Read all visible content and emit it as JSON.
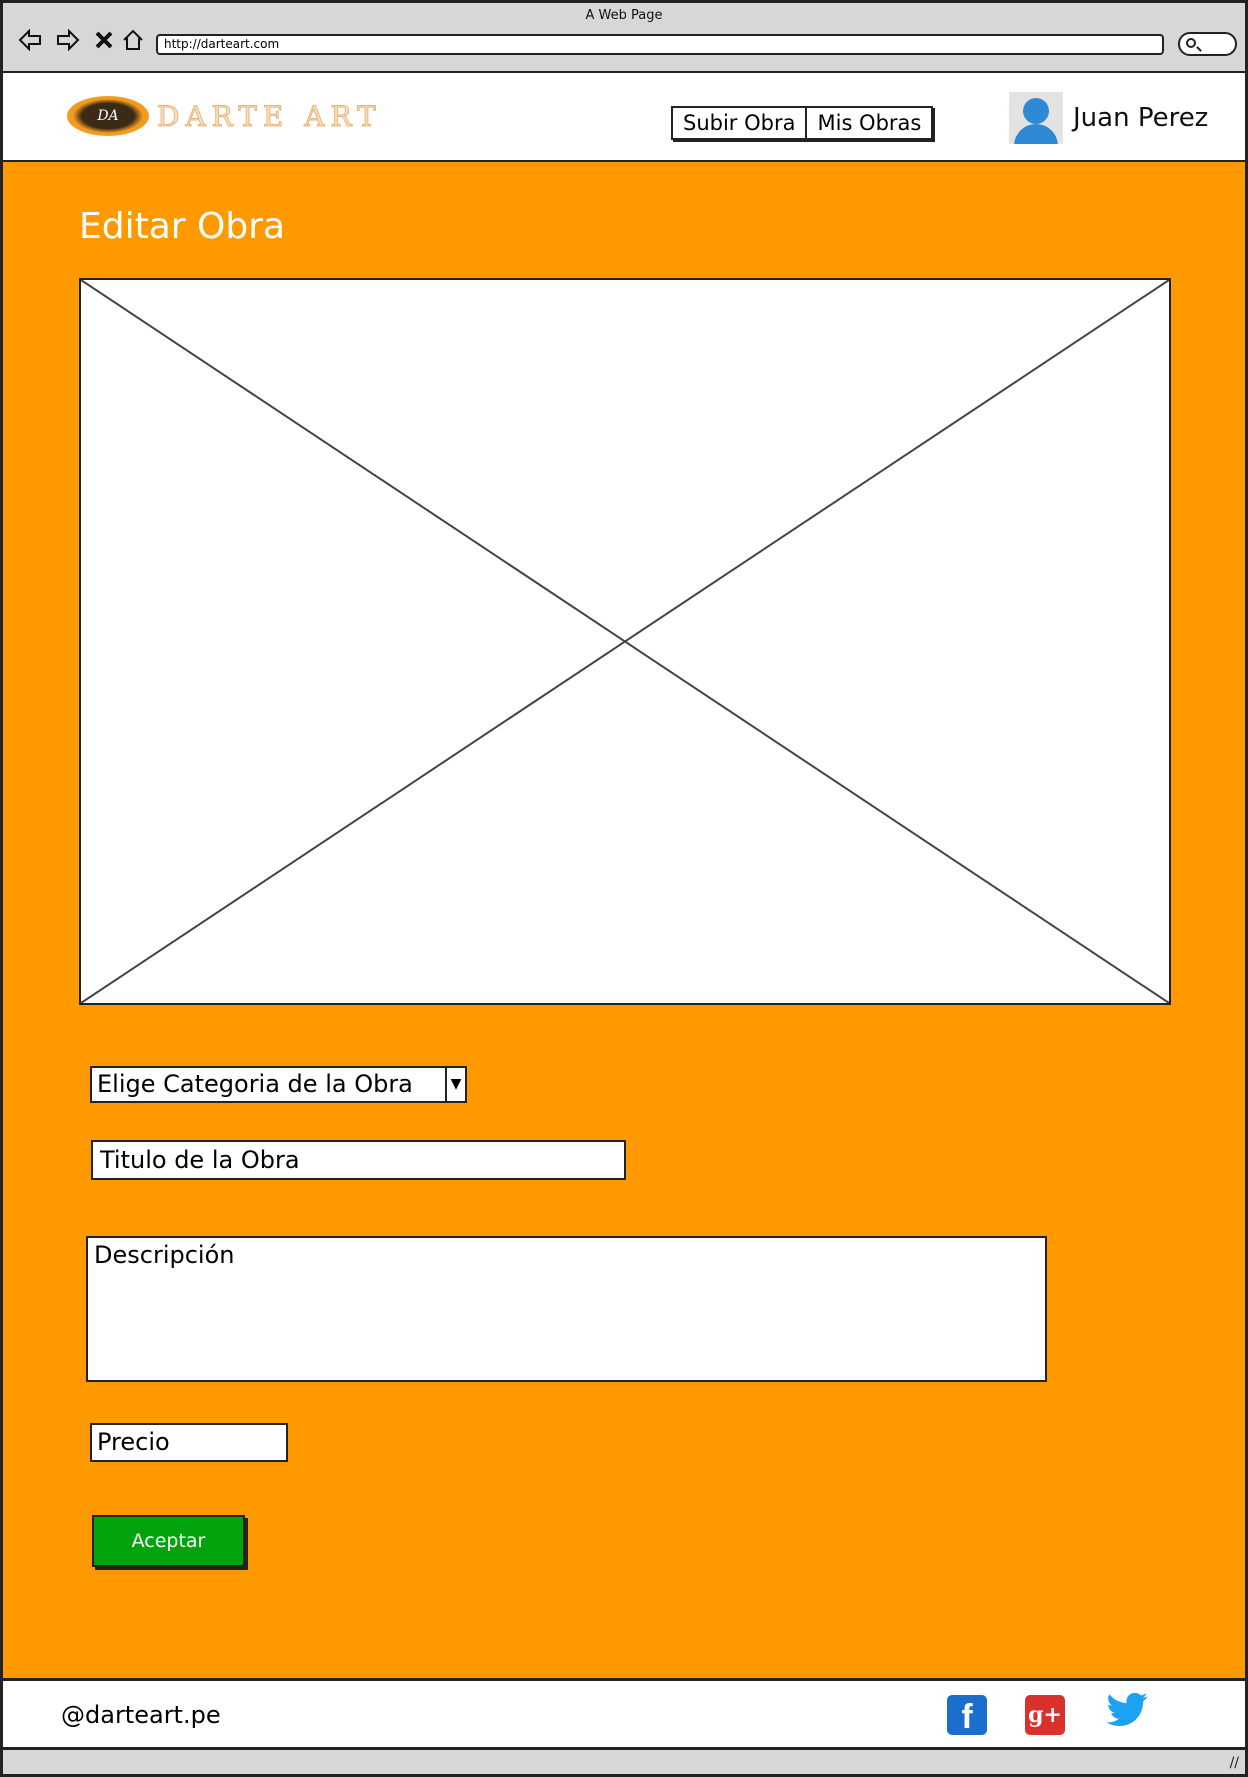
{
  "browser": {
    "window_title": "A Web Page",
    "url": "http://darteart.com",
    "nav_icons": {
      "back": "back-arrow-icon",
      "forward": "forward-arrow-icon",
      "stop": "close-icon",
      "home": "home-icon"
    }
  },
  "header": {
    "logo_mark": "DA",
    "logo_text": "DARTE ART",
    "nav": {
      "upload": "Subir Obra",
      "my_works": "Mis Obras"
    },
    "user_name": "Juan Perez"
  },
  "main": {
    "title": "Editar Obra",
    "form": {
      "category_value": "Elige Categoria de la Obra",
      "title_value": "Titulo de la Obra",
      "description_value": "Descripción",
      "price_value": "Precio",
      "submit_label": "Aceptar"
    }
  },
  "footer": {
    "handle": "@darteart.pe",
    "social_icons": [
      "facebook-icon",
      "google-plus-icon",
      "twitter-icon"
    ]
  },
  "colors": {
    "main_bg": "#fe9900",
    "accept_button": "#03a30e",
    "facebook": "#1b6ecb",
    "google_plus": "#d9312b",
    "twitter": "#1da1f2"
  }
}
